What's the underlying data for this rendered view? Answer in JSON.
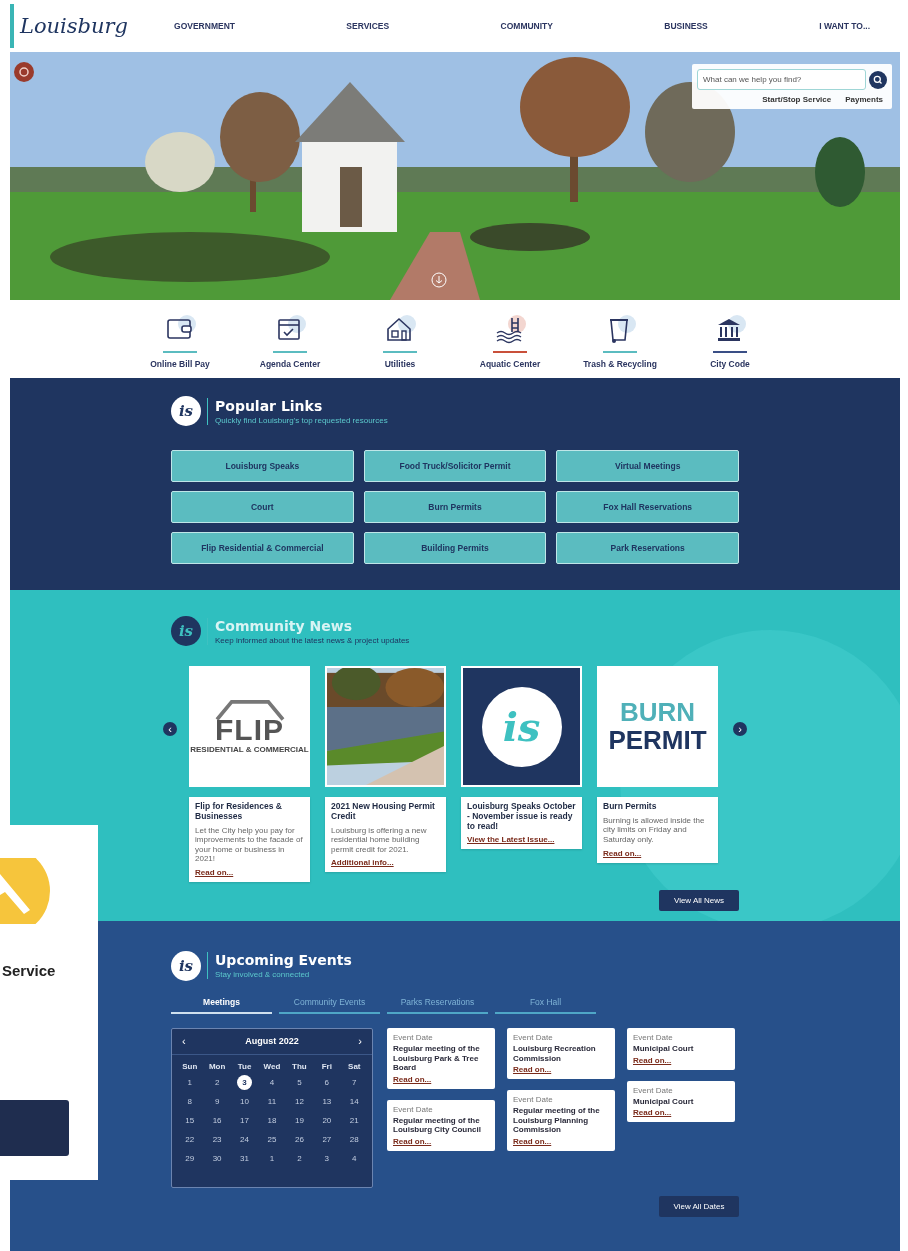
{
  "header": {
    "logo": "Louisburg",
    "nav": [
      "GOVERNMENT",
      "SERVICES",
      "COMMUNITY",
      "BUSINESS",
      "I WANT TO..."
    ]
  },
  "hero": {
    "search": {
      "placeholder": "What can we help you find?"
    },
    "quick_links": [
      "Start/Stop Service",
      "Payments"
    ]
  },
  "shortcuts": [
    {
      "label": "Online Bill Pay",
      "kind": "wallet",
      "color": "#5bbcc0"
    },
    {
      "label": "Agenda Center",
      "kind": "calendar",
      "color": "#5bbcc0"
    },
    {
      "label": "Utilities",
      "kind": "house",
      "color": "#5bbcc0"
    },
    {
      "label": "Aquatic Center",
      "kind": "pool",
      "color": "#c9503a"
    },
    {
      "label": "Trash & Recycling",
      "kind": "bin",
      "color": "#5bbcc0"
    },
    {
      "label": "City Code",
      "kind": "building",
      "color": "#3a4f86"
    }
  ],
  "popular_links": {
    "mark": "is",
    "title": "Popular Links",
    "subtitle": "Quickly find Louisburg's top requested resources",
    "links": [
      "Louisburg Speaks",
      "Food Truck/Solicitor Permit",
      "Virtual Meetings",
      "Court",
      "Burn Permits",
      "Fox Hall Reservations",
      "Flip Residential & Commercial",
      "Building Permits",
      "Park Reservations"
    ]
  },
  "community_news": {
    "mark": "is",
    "title": "Community News",
    "subtitle": "Keep informed about the latest news & project updates",
    "prev": "‹",
    "next": "›",
    "articles": [
      {
        "image": {
          "kind": "flip",
          "texts": [
            "FLIP",
            "RESIDENTIAL & COMMERCIAL"
          ]
        },
        "title": "Flip for Residences & Businesses",
        "summary": "Let the City help you pay for improvements to the facade of your home or business in 2021!",
        "link": "Read on..."
      },
      {
        "title": "2021 New Housing Permit Credit",
        "summary": "Louisburg is offering a new residential home building permit credit for 2021.",
        "link": "Additional info..."
      },
      {
        "image": {
          "kind": "mark",
          "texts": [
            "is"
          ]
        },
        "title": "Louisburg Speaks October - November issue is ready to read!",
        "link": "View the Latest Issue..."
      },
      {
        "image": {
          "kind": "burn",
          "texts": [
            "BURN",
            "PERMIT"
          ]
        },
        "title": "Burn Permits",
        "summary": "Burning is allowed inside the city limits on Friday and Saturday only.",
        "link": "Read on..."
      }
    ],
    "button": "View All News"
  },
  "events": {
    "mark": "is",
    "title": "Upcoming Events",
    "subtitle": "Stay involved & connected",
    "tabs": [
      {
        "label": "Meetings",
        "selected": true
      },
      {
        "label": "Community Events",
        "selected": false
      },
      {
        "label": "Parks Reservations",
        "selected": false
      },
      {
        "label": "Fox Hall",
        "selected": false
      }
    ],
    "calendar": {
      "month": "August 2022",
      "prev": "‹",
      "next": "›",
      "weekdays": [
        "Sun",
        "Mon",
        "Tue",
        "Wed",
        "Thu",
        "Fri",
        "Sat"
      ],
      "weeks": [
        [
          {
            "day": "1",
            "selected": false
          },
          {
            "day": "2",
            "selected": false
          },
          {
            "day": "3",
            "selected": true
          },
          {
            "day": "4",
            "selected": false
          },
          {
            "day": "5",
            "selected": false
          },
          {
            "day": "6",
            "selected": false
          },
          {
            "day": "7",
            "selected": false
          }
        ],
        [
          {
            "day": "8",
            "selected": false
          },
          {
            "day": "9",
            "selected": false
          },
          {
            "day": "10",
            "selected": false
          },
          {
            "day": "11",
            "selected": false
          },
          {
            "day": "12",
            "selected": false
          },
          {
            "day": "13",
            "selected": false
          },
          {
            "day": "14",
            "selected": false
          }
        ],
        [
          {
            "day": "15",
            "selected": false
          },
          {
            "day": "16",
            "selected": false
          },
          {
            "day": "17",
            "selected": false
          },
          {
            "day": "18",
            "selected": false
          },
          {
            "day": "19",
            "selected": false
          },
          {
            "day": "20",
            "selected": false
          },
          {
            "day": "21",
            "selected": false
          }
        ],
        [
          {
            "day": "22",
            "selected": false
          },
          {
            "day": "23",
            "selected": false
          },
          {
            "day": "24",
            "selected": false
          },
          {
            "day": "25",
            "selected": false
          },
          {
            "day": "26",
            "selected": false
          },
          {
            "day": "27",
            "selected": false
          },
          {
            "day": "28",
            "selected": false
          }
        ],
        [
          {
            "day": "29",
            "selected": false
          },
          {
            "day": "30",
            "selected": false
          },
          {
            "day": "31",
            "selected": false
          },
          {
            "day": "1",
            "selected": false
          },
          {
            "day": "2",
            "selected": false
          },
          {
            "day": "3",
            "selected": false
          },
          {
            "day": "4",
            "selected": false
          }
        ]
      ]
    },
    "columns": [
      [
        {
          "date_label": "Event Date",
          "title": "Regular meeting of the Louisburg Park & Tree Board",
          "link": "Read on..."
        },
        {
          "date_label": "Event Date",
          "title": "Regular meeting of the Louisburg City Council",
          "link": "Read on..."
        }
      ],
      [
        {
          "date_label": "Event Date",
          "title": "Louisburg Recreation Commission",
          "link": "Read on..."
        },
        {
          "date_label": "Event Date",
          "title": "Regular meeting of the Louisburg Planning Commission",
          "link": "Read on..."
        }
      ],
      [
        {
          "date_label": "Event Date",
          "title": "Municipal Court",
          "link": "Read on..."
        },
        {
          "date_label": "Event Date",
          "title": "Municipal Court",
          "link": "Read on..."
        }
      ]
    ],
    "button": "View All Dates"
  },
  "overlay_card": {
    "title": "Service"
  }
}
